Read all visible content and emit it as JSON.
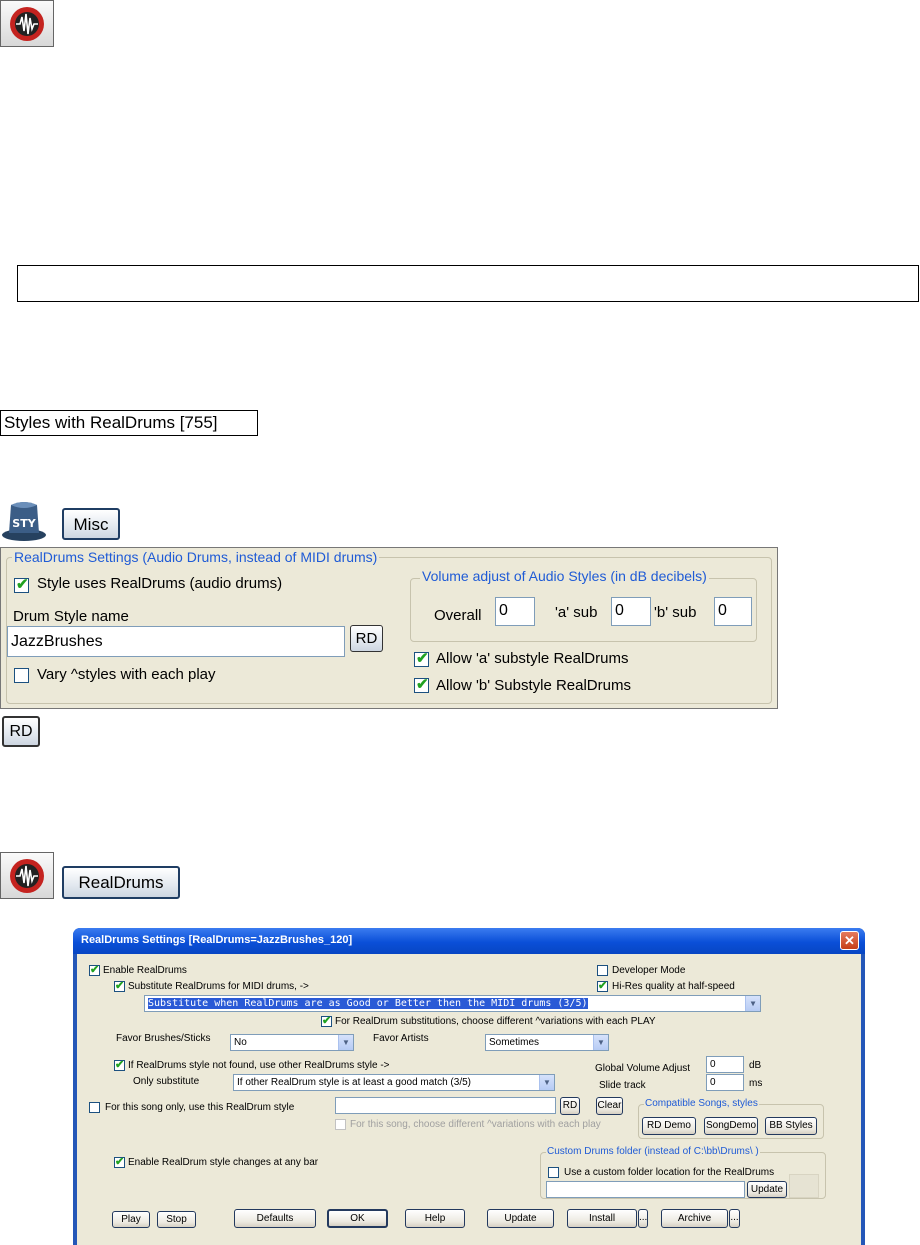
{
  "top_icon": {
    "name": "realdrums-toolbar-icon"
  },
  "empty_box": {
    "text": ""
  },
  "styles_label": "Styles with RealDrums [755]",
  "sty_icon": {
    "name": "style-hat-icon",
    "label": "STY"
  },
  "misc_button": "Misc",
  "misc_panel": {
    "group_title": "RealDrums Settings (Audio Drums, instead of MIDI drums)",
    "style_uses_realdrums": {
      "label": "Style uses RealDrums (audio drums)",
      "checked": true
    },
    "drum_style_name_label": "Drum Style name",
    "drum_style_name_value": "JazzBrushes",
    "rd_button": "RD",
    "vary_styles": {
      "label": "Vary ^styles with each play",
      "checked": false
    },
    "volume_group_title": "Volume adjust of Audio Styles (in dB decibels)",
    "overall_label": "Overall",
    "overall_value": "0",
    "a_sub_label": "'a' sub",
    "a_sub_value": "0",
    "b_sub_label": "'b' sub",
    "b_sub_value": "0",
    "allow_a": {
      "label": "Allow 'a' substyle RealDrums",
      "checked": true
    },
    "allow_b": {
      "label": "Allow 'b' Substyle RealDrums",
      "checked": true
    }
  },
  "rd_small_button": "RD",
  "realdrums_button": "RealDrums",
  "dialog": {
    "title": "RealDrums Settings [RealDrums=JazzBrushes_120]",
    "enable_realdrums": "Enable RealDrums",
    "developer_mode": "Developer Mode",
    "hires_quality": "Hi-Res quality at half-speed",
    "substitute_for_midi": "Substitute RealDrums for MIDI drums, ->",
    "substitute_select": "Substitute when RealDrums are as Good or Better then the MIDI drums          (3/5)",
    "choose_variations": "For RealDrum substitutions, choose different ^variations with each PLAY",
    "favor_brushes_label": "Favor Brushes/Sticks",
    "favor_brushes_value": "No",
    "favor_artists_label": "Favor Artists",
    "favor_artists_value": "Sometimes",
    "if_not_found": "If RealDrums style not found, use other RealDrums style ->",
    "only_substitute_label": "Only substitute",
    "only_substitute_value": "If other RealDrum style is at least a good match          (3/5)",
    "global_volume_label": "Global Volume Adjust",
    "global_volume_value": "0",
    "global_volume_unit": "dB",
    "slide_track_label": "Slide track",
    "slide_track_value": "0",
    "slide_track_unit": "ms",
    "this_song_only": "For this song only, use this RealDrum style",
    "this_song_value": "",
    "rd_button": "RD",
    "clear_button": "Clear",
    "this_song_variations": "For this song, choose different ^variations with each play",
    "compatible_title": "Compatible Songs, styles",
    "rd_demo": "RD Demo",
    "song_demo": "SongDemo",
    "bb_styles": "BB Styles",
    "enable_style_changes": "Enable RealDrum style changes at any bar",
    "custom_folder_title": "Custom Drums folder (instead of C:\\bb\\Drums\\ )",
    "use_custom_folder": "Use a custom folder location for the RealDrums",
    "custom_folder_value": "",
    "update_small": "Update",
    "play": "Play",
    "stop": "Stop",
    "defaults": "Defaults",
    "ok": "OK",
    "help": "Help",
    "update": "Update",
    "install": "Install",
    "install_more": "...",
    "archive": "Archive",
    "archive_more": "..."
  },
  "colors": {
    "accent_blue": "#1f5bd6",
    "check_green": "#21a121",
    "panel_bg": "#ece9d8",
    "titlebar": "#0a4fd8",
    "close_red": "#d9502f"
  }
}
